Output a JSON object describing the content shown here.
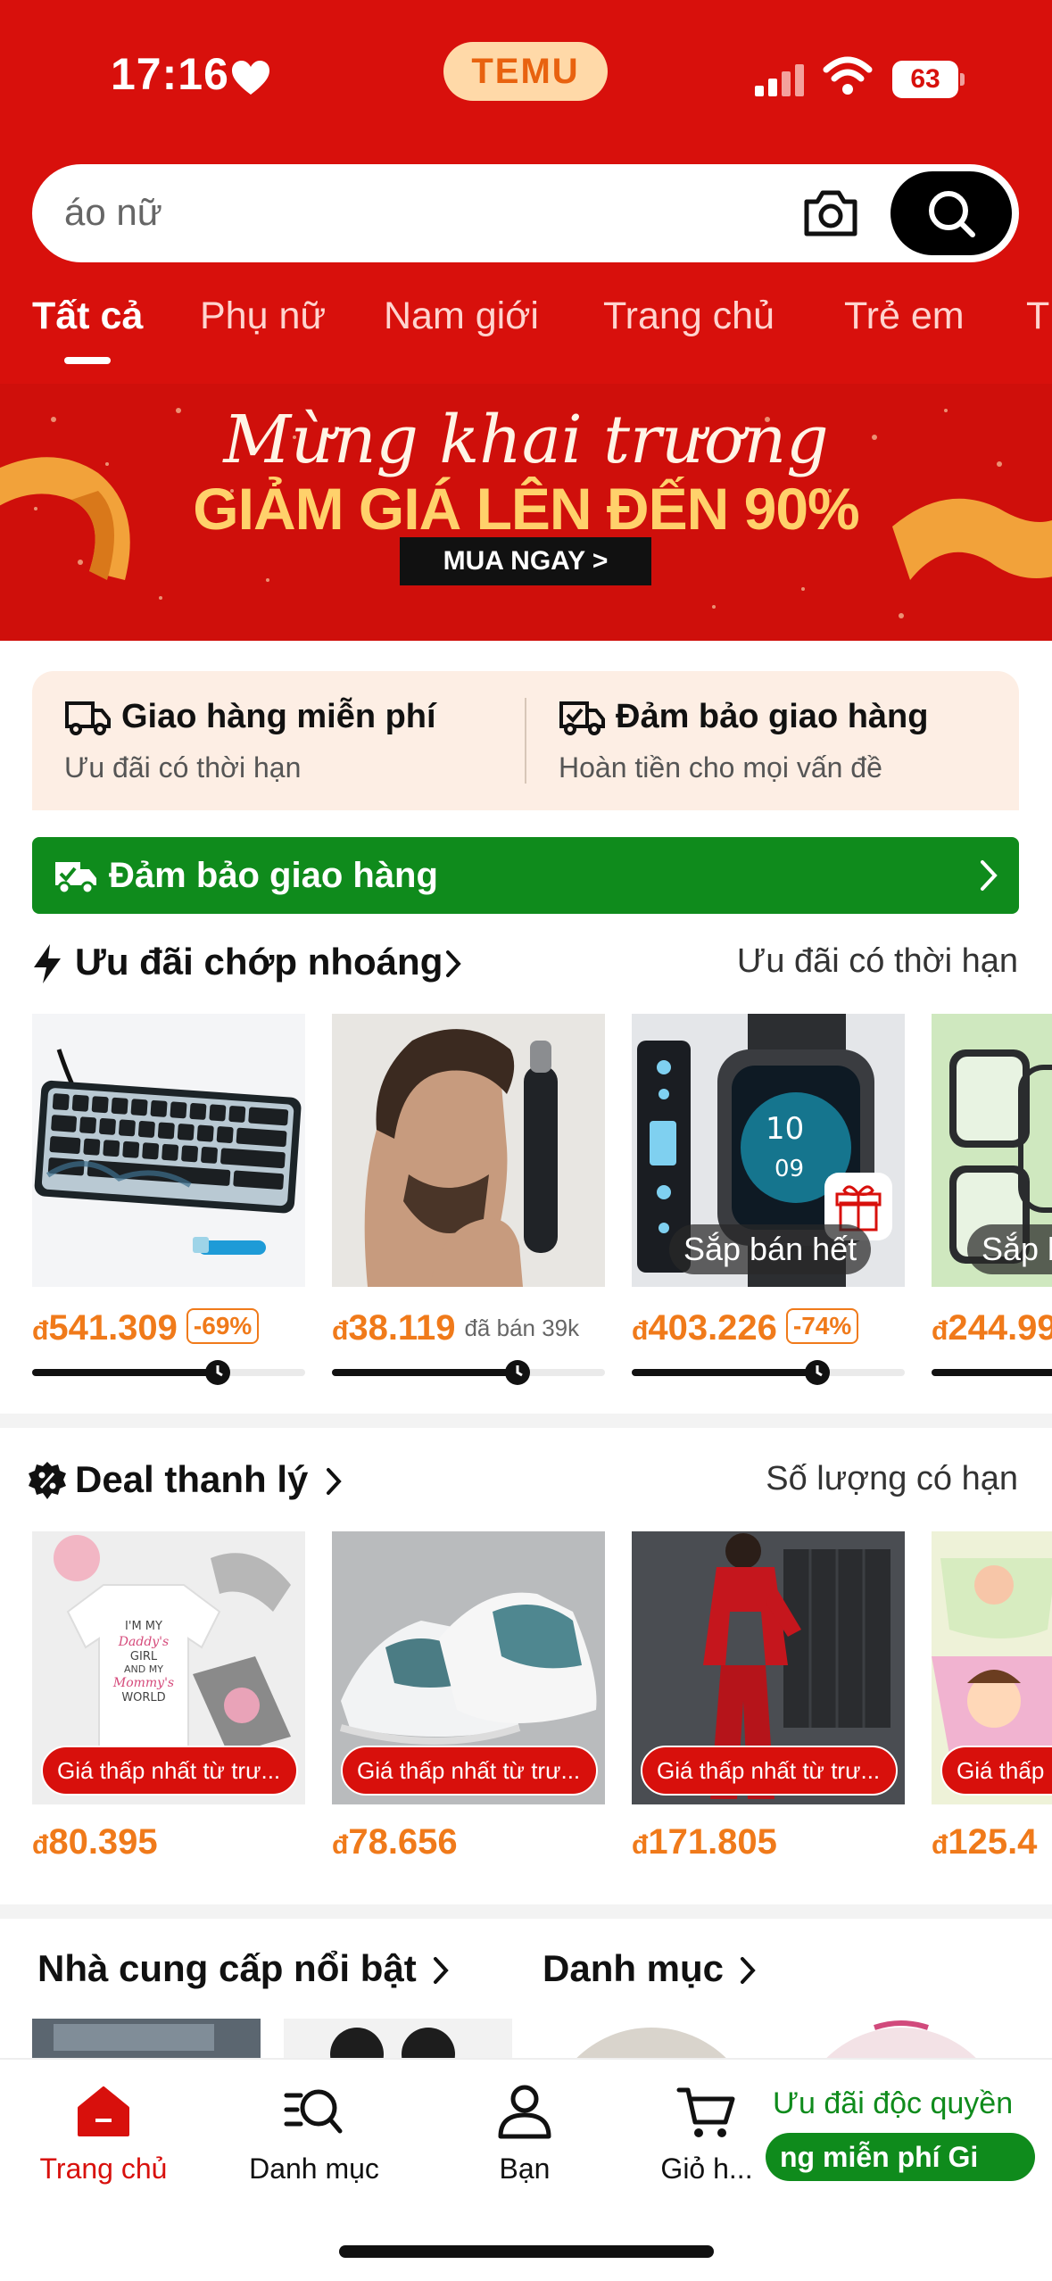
{
  "status_bar": {
    "time": "17:16",
    "battery": "63"
  },
  "logo": {
    "text": "TEMU"
  },
  "search": {
    "value": "áo nữ"
  },
  "tabs": [
    {
      "label": "Tất cả"
    },
    {
      "label": "Phụ nữ"
    },
    {
      "label": "Nam giới"
    },
    {
      "label": "Trang chủ"
    },
    {
      "label": "Trẻ em"
    },
    {
      "label": "T"
    }
  ],
  "banner": {
    "title": "Mừng khai trương",
    "subtitle": "GIẢM GIÁ LÊN ĐẾN 90%",
    "cta": "MUA NGAY >"
  },
  "services": [
    {
      "title": "Giao hàng miễn phí",
      "sub": "Ưu đãi có thời hạn"
    },
    {
      "title": "Đảm bảo giao hàng",
      "sub": "Hoàn tiền cho mọi vấn đề"
    }
  ],
  "delivery_bar": {
    "label": "Đảm bảo giao hàng"
  },
  "flash": {
    "title": "Ưu đãi chớp nhoáng",
    "right": "Ưu đãi có thời hạn",
    "items": [
      {
        "currency": "đ",
        "price": "541.309",
        "badge": "-69%",
        "progress": 0.68
      },
      {
        "currency": "đ",
        "price": "38.119",
        "sold": "đã bán 39k",
        "progress": 0.68
      },
      {
        "currency": "đ",
        "price": "403.226",
        "badge": "-74%",
        "overlay": "Sắp bán hết",
        "progress": 0.68
      },
      {
        "currency": "đ",
        "price": "244.99",
        "overlay": "Sắp b",
        "progress": 0.68
      }
    ]
  },
  "clearance": {
    "title": "Deal thanh lý",
    "right": "Số lượng có hạn",
    "items": [
      {
        "currency": "đ",
        "price": "80.395",
        "pill": "Giá thấp nhất từ trư..."
      },
      {
        "currency": "đ",
        "price": "78.656",
        "pill": "Giá thấp nhất từ trư..."
      },
      {
        "currency": "đ",
        "price": "171.805",
        "pill": "Giá thấp nhất từ trư..."
      },
      {
        "currency": "đ",
        "price": "125.4",
        "pill": "Giá thấp"
      }
    ],
    "image_text": [
      "I'M MY",
      "Daddy's",
      "GIRL",
      "AND MY",
      "Mommy's",
      "WORLD"
    ]
  },
  "bottom_heads": {
    "suppliers": "Nhà cung cấp nổi bật",
    "categories": "Danh mục"
  },
  "tabbar": {
    "items": [
      {
        "label": "Trang chủ"
      },
      {
        "label": "Danh mục"
      },
      {
        "label": "Bạn"
      },
      {
        "label": "Giỏ h..."
      }
    ],
    "promo_title": "Ưu đãi độc quyền",
    "promo_strip": "ng miễn phí   Gi"
  },
  "colors": {
    "brand_red": "#d8100c",
    "price_orange": "#f07a1a",
    "green": "#0f8b1c"
  }
}
